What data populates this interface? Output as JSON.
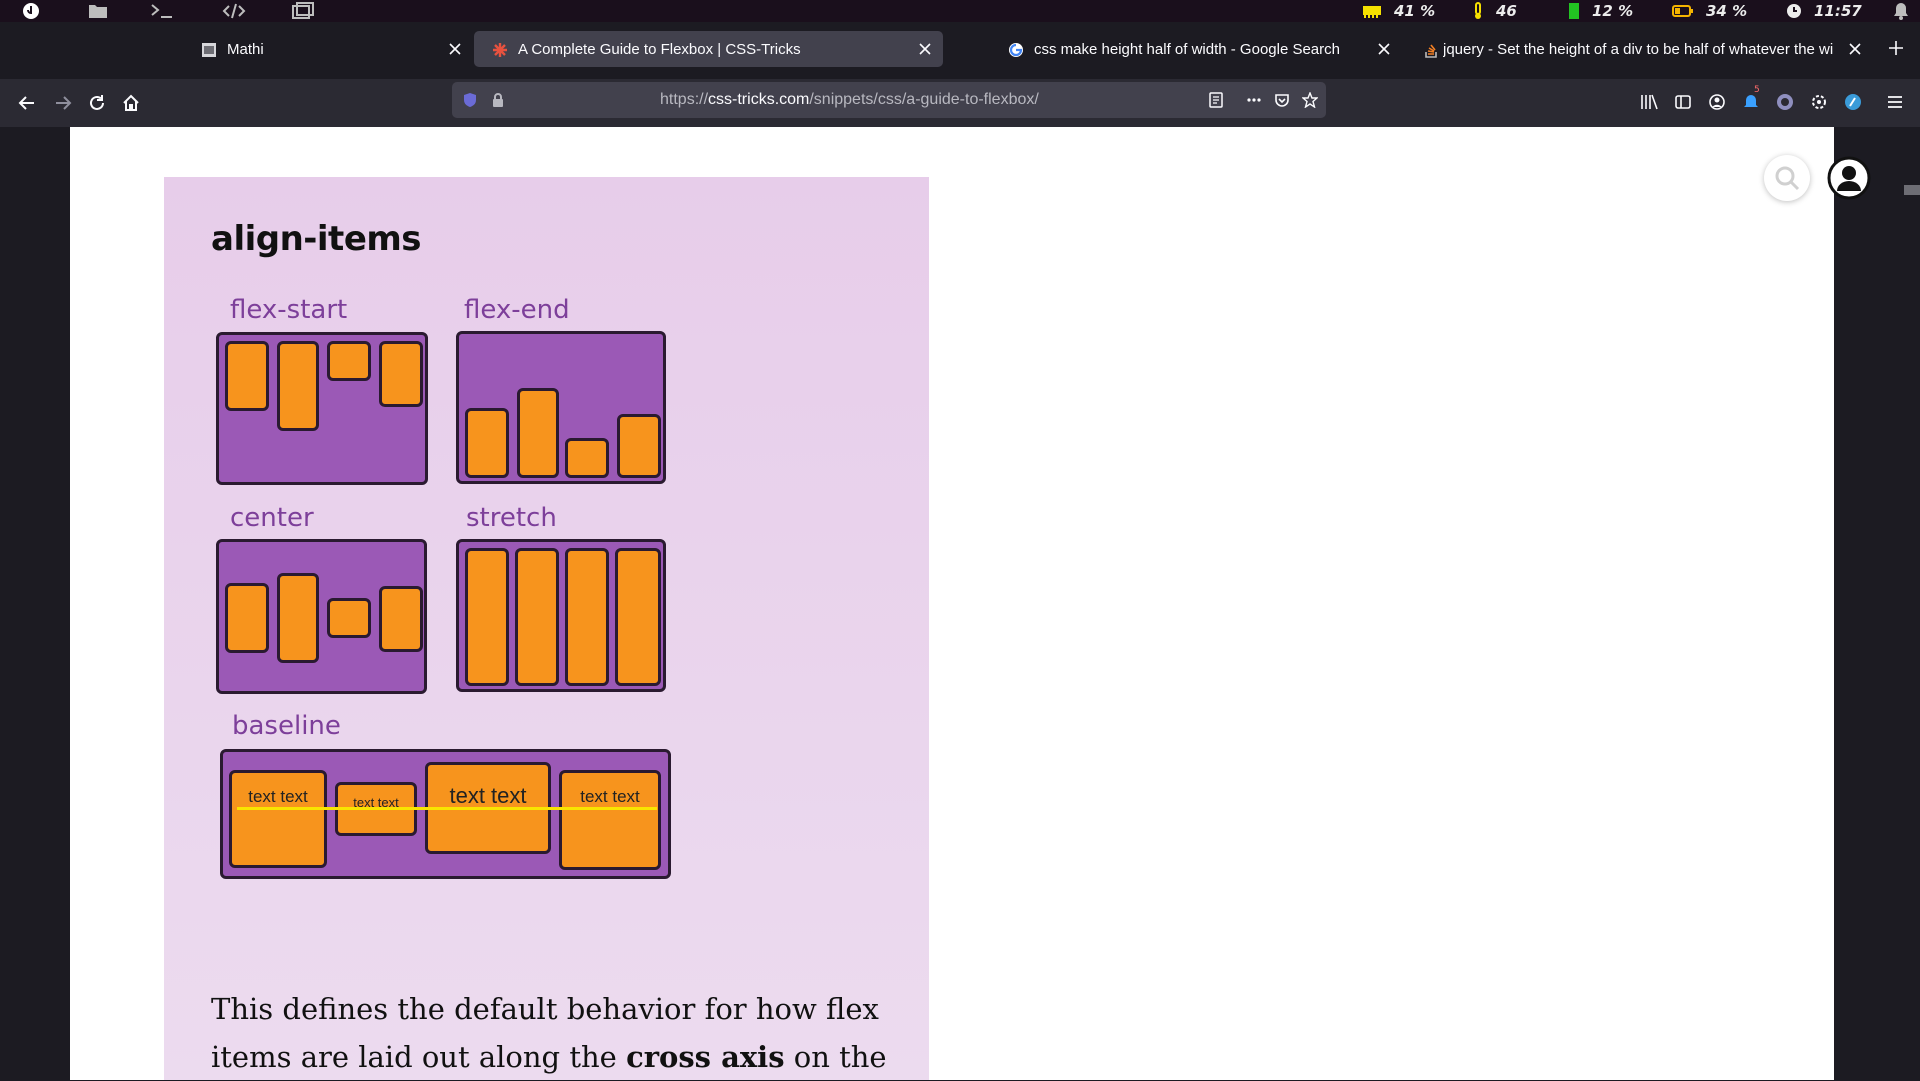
{
  "system_bar": {
    "icons": [
      "fedora-logo-icon",
      "folder-icon",
      "terminal-icon",
      "code-icon",
      "screenshot-icon"
    ],
    "stats": [
      {
        "icon": "memory-icon",
        "value": "41 %",
        "color": "#f5e000"
      },
      {
        "icon": "temperature-icon",
        "value": "46",
        "color": "#f5e000"
      },
      {
        "icon": "cpu-icon",
        "value": "12 %",
        "color": "#22c322"
      },
      {
        "icon": "battery-icon",
        "value": "34 %",
        "color": "#f5b400"
      },
      {
        "icon": "clock-icon",
        "value": "11:57",
        "color": "#ececec"
      }
    ]
  },
  "tabs": [
    {
      "title": "Mathi",
      "favicon": "page-icon",
      "active": false
    },
    {
      "title": "A Complete Guide to Flexbox | CSS-Tricks",
      "favicon": "css-tricks-icon",
      "active": true
    },
    {
      "title": "css make height half of width - Google Search",
      "favicon": "google-icon",
      "active": false
    },
    {
      "title": "jquery - Set the height of a div to be half of whatever the width",
      "favicon": "stackoverflow-icon",
      "active": false
    }
  ],
  "url": {
    "prefix": "https://",
    "host": "css-tricks.com",
    "path": "/snippets/css/a-guide-to-flexbox/"
  },
  "toolbar": {
    "notification_badge": "5"
  },
  "card": {
    "title": "align-items",
    "demos": {
      "flex_start": "flex-start",
      "flex_end": "flex-end",
      "center": "center",
      "stretch": "stretch",
      "baseline": "baseline"
    },
    "baseline_items": [
      "text text",
      "text text",
      "text text",
      "text text"
    ],
    "body_part1": "This defines the default behavior for how flex items are laid out along the ",
    "body_bold": "cross axis",
    "body_part2": " on the"
  },
  "colors": {
    "card_bg": "#e9d3ec",
    "flex_container": "#9b59b6",
    "flex_item": "#f7941d",
    "label": "#7d3f9a",
    "baseline": "#f9e400"
  }
}
